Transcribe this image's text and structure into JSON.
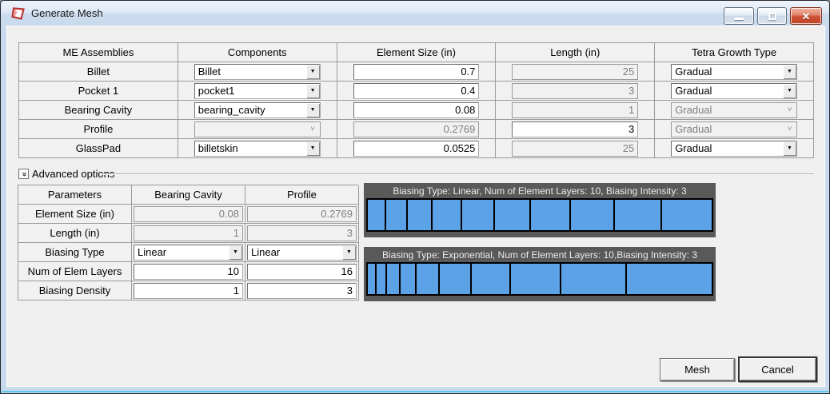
{
  "window": {
    "title": "Generate Mesh"
  },
  "mesh_table": {
    "headers": [
      "ME Assemblies",
      "Components",
      "Element Size (in)",
      "Length (in)",
      "Tetra Growth Type"
    ],
    "rows": [
      {
        "assembly": "Billet",
        "component": "Billet",
        "element_size": "0.7",
        "length": "25",
        "growth": "Gradual"
      },
      {
        "assembly": "Pocket 1",
        "component": "pocket1",
        "element_size": "0.4",
        "length": "3",
        "growth": "Gradual"
      },
      {
        "assembly": "Bearing Cavity",
        "component": "bearing_cavity",
        "element_size": "0.08",
        "length": "1",
        "growth": "Gradual"
      },
      {
        "assembly": "Profile",
        "component": "",
        "element_size": "0.2769",
        "length": "3",
        "growth": "Gradual"
      },
      {
        "assembly": "GlassPad",
        "component": "billetskin",
        "element_size": "0.0525",
        "length": "25",
        "growth": "Gradual"
      }
    ]
  },
  "advanced": {
    "label": "Advanced options"
  },
  "params_table": {
    "headers": [
      "Parameters",
      "Bearing Cavity",
      "Profile"
    ],
    "rows": [
      {
        "label": "Element Size (in)",
        "bearing_cavity": "0.08",
        "profile": "0.2769"
      },
      {
        "label": "Length (in)",
        "bearing_cavity": "1",
        "profile": "3"
      },
      {
        "label": "Biasing Type",
        "bearing_cavity": "Linear",
        "profile": "Linear"
      },
      {
        "label": "Num of Elem Layers",
        "bearing_cavity": "10",
        "profile": "16"
      },
      {
        "label": "Biasing Density",
        "bearing_cavity": "1",
        "profile": "3"
      }
    ]
  },
  "diagrams": [
    {
      "title": "Biasing Type: Linear, Num of Element Layers: 10, Biasing Intensity: 3",
      "num_layers": 10,
      "biasing_intensity": 3,
      "biasing_type": "Linear",
      "cells": [
        1,
        1.22,
        1.44,
        1.67,
        1.89,
        2.11,
        2.33,
        2.56,
        2.78,
        3
      ]
    },
    {
      "title": "Biasing Type: Exponential, Num of Element Layers: 10,Biasing Intensity: 3",
      "num_layers": 10,
      "biasing_intensity": 3,
      "biasing_type": "Exponential",
      "cells": [
        1,
        1.17,
        1.5,
        2,
        2.83,
        4,
        5,
        6.5,
        8.5,
        11.3
      ]
    }
  ],
  "buttons": {
    "mesh": "Mesh",
    "cancel": "Cancel"
  },
  "colors": {
    "element_fill": "#5ba3e6",
    "panel_header": "#595959",
    "titlebar": "#d5e3f2"
  }
}
